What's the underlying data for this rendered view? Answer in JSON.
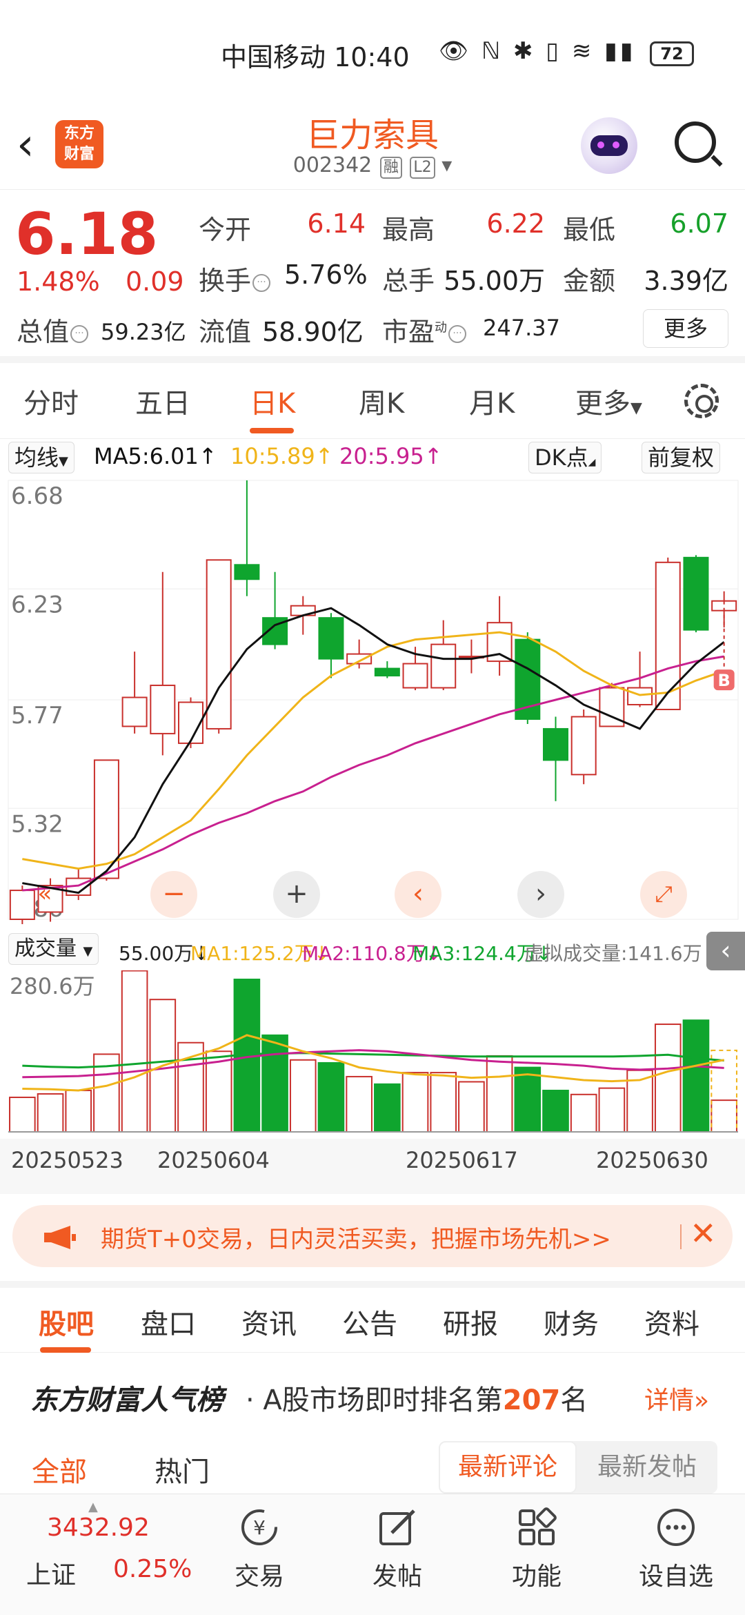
{
  "status": {
    "carrier": "中国移动",
    "time": "10:40",
    "battery": "72"
  },
  "header": {
    "title": "巨力索具",
    "code": "002342",
    "tag1": "融",
    "tag2": "L2",
    "logo_line1": "东方",
    "logo_line2": "财富"
  },
  "quote": {
    "price": "6.18",
    "pct": "1.48%",
    "chg": "0.09",
    "open_label": "今开",
    "open": "6.14",
    "high_label": "最高",
    "high": "6.22",
    "low_label": "最低",
    "low": "6.07",
    "turnover_label": "换手",
    "turnover": "5.76%",
    "vol_label": "总手",
    "vol": "55.00万",
    "amount_label": "金额",
    "amount": "3.39亿",
    "mktcap_label": "总值",
    "mktcap": "59.23亿",
    "float_label": "流值",
    "float": "58.90亿",
    "pe_label": "市盈",
    "pe_sup": "动",
    "pe": "247.37",
    "more": "更多"
  },
  "period_tabs": [
    "分时",
    "五日",
    "日K",
    "周K",
    "月K",
    "更多"
  ],
  "ma_row": {
    "ma_type": "均线",
    "ma5": "MA5:6.01",
    "ma10": "10:5.89",
    "ma20": "20:5.95",
    "dk": "DK点",
    "fq": "前复权"
  },
  "vol_row": {
    "label": "成交量",
    "vol": "55.00万",
    "ma1": "MA1:125.2万",
    "ma2": "MA2:110.8万",
    "ma3": "MA3:124.4万",
    "virtual": "虚拟成交量:141.6万"
  },
  "colors": {
    "up": "#c9302c",
    "down": "#0fa52e",
    "ma5": "#111111",
    "ma10": "#f0b419",
    "ma20": "#c8208f",
    "accent": "#f05a22"
  },
  "chart_data": {
    "type": "candlestick",
    "price_ticks": [
      "6.68",
      "6.23",
      "5.77",
      "5.32",
      "4.86"
    ],
    "ylim": [
      4.86,
      6.68
    ],
    "dates": [
      "20250523",
      "20250604",
      "20250617",
      "20250630"
    ],
    "candles": [
      {
        "o": 4.86,
        "c": 4.98,
        "h": 5.0,
        "l": 4.84
      },
      {
        "o": 4.89,
        "c": 5.0,
        "h": 5.03,
        "l": 4.85
      },
      {
        "o": 4.96,
        "c": 5.03,
        "h": 5.07,
        "l": 4.94
      },
      {
        "o": 5.03,
        "c": 5.52,
        "h": 5.52,
        "l": 5.02
      },
      {
        "o": 5.66,
        "c": 5.78,
        "h": 5.97,
        "l": 5.63
      },
      {
        "o": 5.63,
        "c": 5.83,
        "h": 6.3,
        "l": 5.54
      },
      {
        "o": 5.59,
        "c": 5.76,
        "h": 5.78,
        "l": 5.57
      },
      {
        "o": 5.65,
        "c": 6.35,
        "h": 6.35,
        "l": 5.63
      },
      {
        "o": 6.33,
        "c": 6.27,
        "h": 6.68,
        "l": 6.2
      },
      {
        "o": 6.11,
        "c": 6.0,
        "h": 6.3,
        "l": 5.98
      },
      {
        "o": 6.12,
        "c": 6.16,
        "h": 6.2,
        "l": 6.04
      },
      {
        "o": 6.11,
        "c": 5.94,
        "h": 6.13,
        "l": 5.86
      },
      {
        "o": 5.92,
        "c": 5.96,
        "h": 6.02,
        "l": 5.9
      },
      {
        "o": 5.9,
        "c": 5.87,
        "h": 5.93,
        "l": 5.86
      },
      {
        "o": 5.82,
        "c": 5.92,
        "h": 5.99,
        "l": 5.81
      },
      {
        "o": 5.82,
        "c": 6.0,
        "h": 6.1,
        "l": 5.81
      },
      {
        "o": 5.95,
        "c": 5.95,
        "h": 6.02,
        "l": 5.88
      },
      {
        "o": 5.93,
        "c": 6.09,
        "h": 6.2,
        "l": 5.87
      },
      {
        "o": 6.02,
        "c": 5.69,
        "h": 6.05,
        "l": 5.67
      },
      {
        "o": 5.65,
        "c": 5.52,
        "h": 5.7,
        "l": 5.35
      },
      {
        "o": 5.46,
        "c": 5.7,
        "h": 5.73,
        "l": 5.42
      },
      {
        "o": 5.66,
        "c": 5.82,
        "h": 5.84,
        "l": 5.66
      },
      {
        "o": 5.75,
        "c": 5.82,
        "h": 5.97,
        "l": 5.74
      },
      {
        "o": 5.73,
        "c": 6.34,
        "h": 6.36,
        "l": 5.73
      },
      {
        "o": 6.36,
        "c": 6.06,
        "h": 6.37,
        "l": 6.05
      },
      {
        "o": 6.14,
        "c": 6.18,
        "h": 6.22,
        "l": 6.07
      }
    ],
    "ma5": [
      5.01,
      4.99,
      4.97,
      5.06,
      5.2,
      5.42,
      5.6,
      5.82,
      5.98,
      6.08,
      6.12,
      6.15,
      6.08,
      6.0,
      5.96,
      5.94,
      5.94,
      5.96,
      5.9,
      5.83,
      5.75,
      5.7,
      5.65,
      5.8,
      5.92,
      6.01
    ],
    "ma10": [
      5.11,
      5.09,
      5.07,
      5.09,
      5.13,
      5.2,
      5.27,
      5.4,
      5.54,
      5.66,
      5.78,
      5.87,
      5.93,
      5.99,
      6.02,
      6.03,
      6.04,
      6.05,
      6.03,
      5.97,
      5.89,
      5.83,
      5.79,
      5.8,
      5.85,
      5.89
    ],
    "ma20": [
      4.98,
      4.99,
      5.0,
      5.05,
      5.1,
      5.15,
      5.21,
      5.26,
      5.3,
      5.35,
      5.39,
      5.45,
      5.5,
      5.54,
      5.59,
      5.63,
      5.67,
      5.71,
      5.74,
      5.77,
      5.8,
      5.83,
      5.86,
      5.9,
      5.93,
      5.95
    ],
    "volume_max_label": "280.6万",
    "volumes": [
      60,
      66,
      72,
      135,
      280,
      230,
      155,
      140,
      265,
      168,
      125,
      120,
      96,
      83,
      103,
      103,
      87,
      132,
      112,
      72,
      65,
      76,
      107,
      187,
      194,
      55
    ],
    "vol_ma1": [
      75,
      74,
      72,
      80,
      95,
      115,
      130,
      145,
      168,
      155,
      140,
      128,
      112,
      105,
      100,
      98,
      94,
      96,
      100,
      95,
      90,
      88,
      90,
      105,
      115,
      125
    ],
    "vol_ma2": [
      95,
      96,
      97,
      100,
      105,
      110,
      116,
      122,
      130,
      135,
      138,
      140,
      142,
      140,
      135,
      130,
      125,
      122,
      120,
      118,
      115,
      110,
      108,
      110,
      114,
      111
    ],
    "vol_ma3": [
      115,
      113,
      112,
      114,
      118,
      122,
      126,
      130,
      135,
      136,
      137,
      136,
      135,
      134,
      133,
      132,
      131,
      131,
      131,
      131,
      131,
      131,
      132,
      134,
      128,
      124
    ],
    "virtual_volume": 141.6,
    "vol_ylim": [
      0,
      280.6
    ],
    "marker": "B"
  },
  "banner": {
    "text": "期货T+0交易，日内灵活买卖，把握市场先机>>"
  },
  "content_tabs": [
    "股吧",
    "盘口",
    "资讯",
    "公告",
    "研报",
    "财务",
    "资料"
  ],
  "rank": {
    "brand": "东方财富人气榜",
    "prefix": "· A股市场即时排名第",
    "num": "207",
    "suffix": "名",
    "more": "详情"
  },
  "filter": {
    "all": "全部",
    "hot": "热门",
    "latest_comment": "最新评论",
    "latest_post": "最新发帖"
  },
  "bottom_nav": {
    "index_value": "3432.92",
    "index_name": "上证",
    "index_pct": "0.25%",
    "items": [
      "交易",
      "发帖",
      "功能",
      "设自选"
    ]
  }
}
